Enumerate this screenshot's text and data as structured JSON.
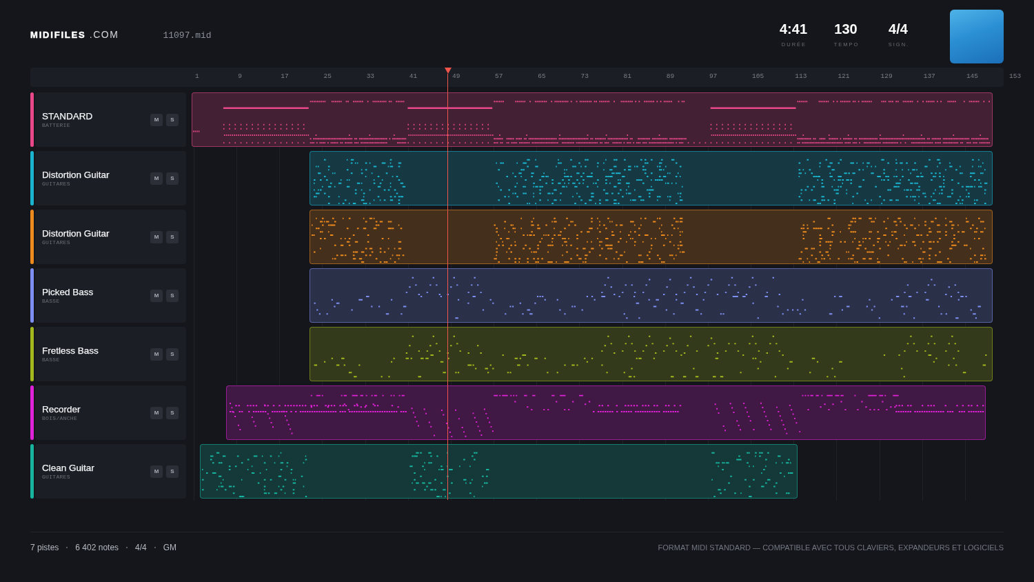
{
  "header": {
    "logo": "**MIDIFILES** .COM",
    "filename": "11097.mid",
    "stats": [
      {
        "value": "4:41",
        "label": "DURÉE"
      },
      {
        "value": "130",
        "label": "TEMPO"
      },
      {
        "value": "4/4",
        "label": "SIGN."
      }
    ]
  },
  "ruler": {
    "labels": [
      "1",
      "9",
      "17",
      "25",
      "33",
      "41",
      "49",
      "57",
      "65",
      "73",
      "81",
      "89",
      "97",
      "105",
      "113",
      "121",
      "129",
      "137",
      "145",
      "153"
    ]
  },
  "playhead": {
    "level": 0.429
  },
  "tracks": [
    {
      "name": "STANDARD",
      "category": "BATTERIE",
      "color": "#e8488a",
      "kind": "drums",
      "buttons": [
        "M",
        "S"
      ]
    },
    {
      "name": "Distortion Guitar",
      "category": "GUITARES",
      "color": "#1ab4cf",
      "kind": "chords",
      "buttons": [
        "M",
        "S"
      ]
    },
    {
      "name": "Distortion Guitar",
      "category": "GUITARES",
      "color": "#ec8a1e",
      "kind": "chords",
      "buttons": [
        "M",
        "S"
      ]
    },
    {
      "name": "Picked Bass",
      "category": "BASSE",
      "color": "#7d8ff0",
      "kind": "bass",
      "buttons": [
        "M",
        "S"
      ]
    },
    {
      "name": "Fretless Bass",
      "category": "BASSE",
      "color": "#a3b81c",
      "kind": "bass",
      "buttons": [
        "M",
        "S"
      ]
    },
    {
      "name": "Recorder",
      "category": "BOIS/ANCHE",
      "color": "#df22d8",
      "kind": "melody",
      "buttons": [
        "M",
        "S"
      ]
    },
    {
      "name": "Clean Guitar",
      "category": "GUITARES",
      "color": "#16b39e",
      "kind": "chords",
      "buttons": [
        "M",
        "S"
      ]
    }
  ],
  "footer": {
    "stats": [
      "7 pistes",
      "6 402 notes",
      "4/4",
      "GM"
    ],
    "note": "FORMAT MIDI STANDARD — COMPATIBLE AVEC TOUS CLAVIERS, EXPANDEURS ET LOGICIELS"
  }
}
